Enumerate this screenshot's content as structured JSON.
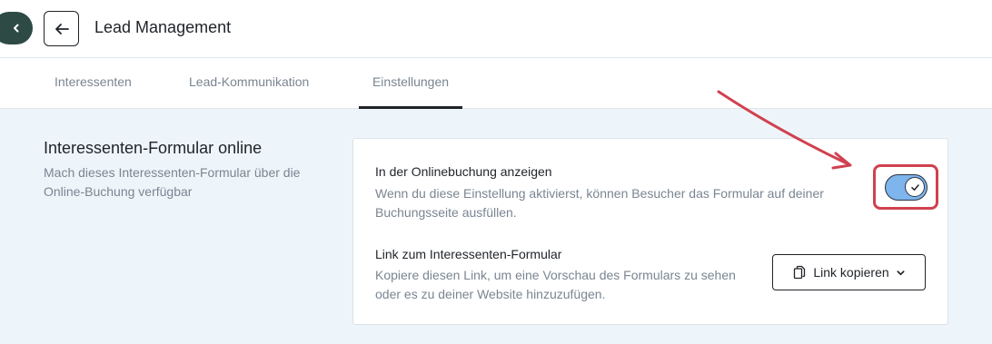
{
  "header": {
    "title": "Lead Management"
  },
  "tabs": [
    {
      "label": "Interessenten",
      "active": false
    },
    {
      "label": "Lead-Kommunikation",
      "active": false
    },
    {
      "label": "Einstellungen",
      "active": true
    }
  ],
  "section": {
    "title": "Interessenten-Formular online",
    "description": "Mach dieses Interessenten-Formular über die Online-Buchung verfügbar"
  },
  "settings": {
    "online_booking": {
      "title": "In der Onlinebuchung anzeigen",
      "description": "Wenn du diese Einstellung aktivierst, können Besucher das Formular auf deiner Buchungsseite ausfüllen.",
      "enabled": true
    },
    "form_link": {
      "title": "Link zum Interessenten-Formular",
      "description": "Kopiere diesen Link, um eine Vorschau des Formulars zu sehen oder es zu deiner Website hinzuzufügen.",
      "button_label": "Link kopieren"
    }
  },
  "colors": {
    "sidebar_toggle": "#2e4a45",
    "toggle_on": "#7db5ec",
    "annotation": "#d0414f",
    "page_background": "#eef5fa"
  },
  "icons": {
    "sidebar_toggle": "chevron-left-icon",
    "back": "arrow-left-icon",
    "toggle": "check-icon",
    "copy": "copy-icon",
    "dropdown": "chevron-down-icon"
  }
}
